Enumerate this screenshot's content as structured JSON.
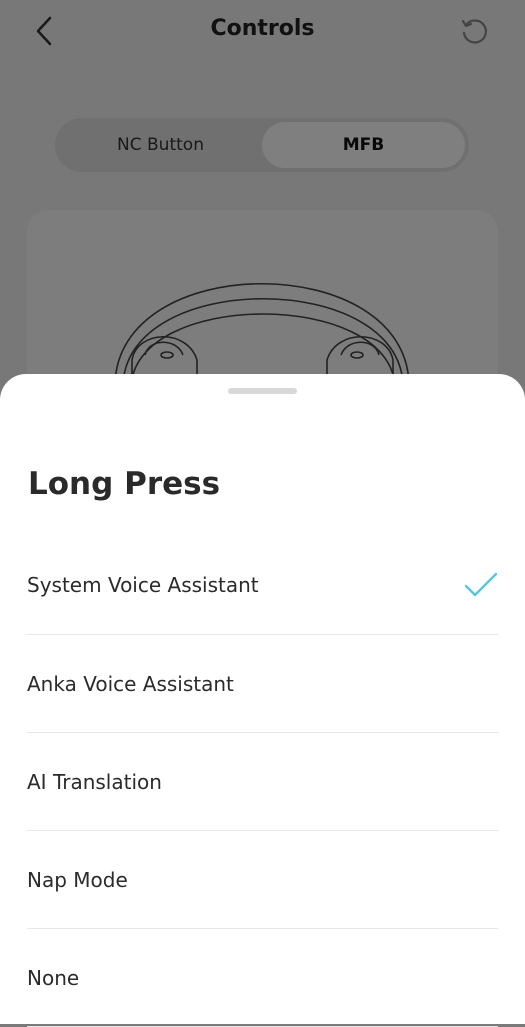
{
  "header": {
    "title": "Controls",
    "back_icon": "chevron-left-icon",
    "reset_icon": "reset-icon"
  },
  "segment": {
    "items": [
      {
        "label": "NC Button",
        "active": false
      },
      {
        "label": "MFB",
        "active": true
      }
    ]
  },
  "sheet": {
    "title": "Long Press",
    "options": [
      {
        "label": "System Voice Assistant",
        "selected": true
      },
      {
        "label": "Anka Voice Assistant",
        "selected": false
      },
      {
        "label": "AI Translation",
        "selected": false
      },
      {
        "label": "Nap Mode",
        "selected": false
      },
      {
        "label": "None",
        "selected": false
      }
    ],
    "check_icon": "checkmark-icon"
  },
  "colors": {
    "accent": "#56c6dc",
    "overlay": "rgba(0,0,0,0.5)"
  }
}
